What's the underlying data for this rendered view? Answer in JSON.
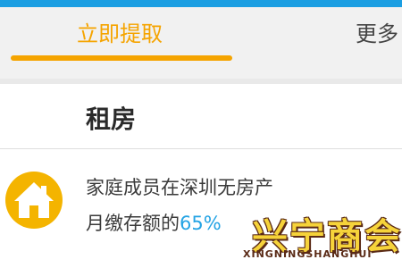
{
  "tabs": {
    "active_label": "立即提取",
    "more_label": "更多"
  },
  "card": {
    "title": "租房",
    "item": {
      "icon": "house-icon",
      "line1": "家庭成员在深圳无房产",
      "line2_prefix": "月缴存额的",
      "line2_percent": "65%"
    }
  },
  "watermark": {
    "text": "兴宁商会",
    "subtext": "XINGNINGSHANGHUI"
  },
  "colors": {
    "accent": "#f5a400",
    "topbar": "#1b9ee2",
    "highlight": "#23a3e4"
  }
}
